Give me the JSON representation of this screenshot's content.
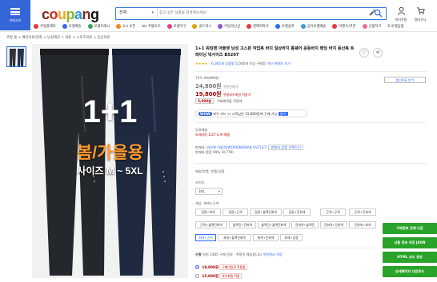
{
  "header": {
    "menu_label": "카테고리",
    "logo": [
      "c",
      "o",
      "u",
      "p",
      "a",
      "n",
      "g"
    ],
    "search_category": "전체",
    "search_placeholder": "찾고 싶은 상품을 검색해보세요!",
    "mypage_label": "마이쿠팡",
    "cart_label": "장바구니"
  },
  "categories": [
    {
      "label": "쿠팡플레이",
      "color": "#e23b3b"
    },
    {
      "label": "로켓배송",
      "color": "#2e6be6"
    },
    {
      "label": "로켓프레시",
      "color": "#37a75a"
    },
    {
      "label": "2시 오픈",
      "color": "#f08a1a"
    },
    {
      "label": "biz 쿠팡비즈",
      "color": "#5a5a5a"
    },
    {
      "label": "로켓직구",
      "color": "#e33c8e"
    },
    {
      "label": "골드박스",
      "color": "#d9a400"
    },
    {
      "label": "이달의신상",
      "color": "#8b57d6"
    },
    {
      "label": "판매자특가",
      "color": "#e23b3b"
    },
    {
      "label": "로켓설치",
      "color": "#2e6be6"
    },
    {
      "label": "공유로켓배송",
      "color": "#3aa0d8"
    },
    {
      "label": "이벤트/쿠폰",
      "color": "#e23b3b"
    },
    {
      "label": "선물하기",
      "color": "#e86a9a"
    },
    {
      "label": "R 로켓상품",
      "color": "#2e6be6"
    }
  ],
  "breadcrumb": "쿠팡 홈 > 패션의류/잡화 > 남성패션 > 의류 > 스포츠의류 > 등산의류",
  "product": {
    "title": "1+1 워킹맨 아울렛 남성 고스판 작업복 바지 일상바지 홈웨어 운동바지 밴딩 바지 등산복 트레이닝 빅사이즈 B5207",
    "stars": "★★★★☆",
    "review_count": "6,385개 상품평",
    "brand_rating": "5,000개 이상 구매함",
    "seller_link": "기타 판매자 보기",
    "image_text_big": "1+1",
    "image_text_season": "봄/가을용",
    "image_text_size": "사이즈 M ~ 5XL"
  },
  "pricing": {
    "discount": "70%",
    "original_price": "53,000원",
    "price1": "24,800원",
    "price1_tag": "쿠팡판매가",
    "price2": "19,800원",
    "price2_tag": "쿠팡와우회원 적용가",
    "coupon_amount": "5,000원",
    "coupon_text": "구매혜택을 적용해",
    "deal_button": "할인쿠폰 받기"
  },
  "wow": {
    "badge": "WOW",
    "text": "와우 카드 시 고객님은 15,800원에 구매 가능",
    "apply_label": "받기"
  },
  "shipping": {
    "line1": "무료배송",
    "line2": "모레(화) 1/27 도착 예정"
  },
  "seller": {
    "line1_prefix": "판매자:",
    "seller_name": "워킹맨 아울렛(WORKINGMAN OUTLET)",
    "contact_button": "판매자 상품 브랜드인",
    "line2": "판매자 평점 99% (9,779)"
  },
  "returns": "배송/반품: 반품/교환",
  "options": {
    "size_label": "사이즈",
    "size_value": "3XL",
    "color_label": "색상: 회색+곤색",
    "colors": [
      "검정+회색",
      "검정+곤색",
      "검정+블랙진회색",
      "검정+진회색",
      "곤색+곤색",
      "곤색+진회색",
      "곤색+블랙진회색",
      "블랙진+진회색",
      "블랙진+블랙진회색",
      "진회색+블랙진",
      "진회색+진회색",
      "진회색+회색",
      "회색+곤색",
      "회색+블랙진회색",
      "회색+진회색",
      "회색+검정"
    ],
    "selected_color": "회색+곤색"
  },
  "quantity": {
    "label": "수량",
    "text": "외의 1585 구매 완료 · 쿠팡이 예상합니다",
    "link": "쿠팡에서 적립",
    "more": "판매자 보기 ▾"
  },
  "sellers": [
    {
      "price": "19,800원",
      "tag": "구매이용권 적용됨"
    },
    {
      "price": "15,800원",
      "tag": "와우회원 적용"
    }
  ],
  "side_buttons": [
    "구매정보 전체 다운",
    "상품 정보 저장 JSON",
    "HTML 코드 생성",
    "상세페이지 다운로드"
  ]
}
